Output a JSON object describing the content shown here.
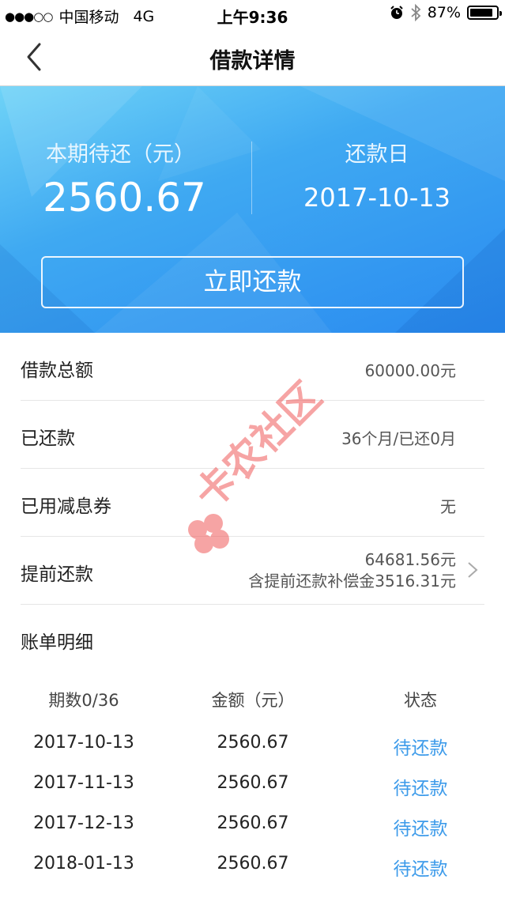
{
  "status_bar": {
    "carrier": "中国移动",
    "network": "4G",
    "time": "上午9:36",
    "battery": "87%",
    "battery_level": 0.87
  },
  "nav": {
    "title": "借款详情"
  },
  "summary": {
    "due_label": "本期待还（元）",
    "due_amount": "2560.67",
    "date_label": "还款日",
    "date_value": "2017-10-13",
    "repay_button": "立即还款"
  },
  "details": [
    {
      "label": "借款总额",
      "value": "60000.00元"
    },
    {
      "label": "已还款",
      "value": "36个月/已还0月"
    },
    {
      "label": "已用减息券",
      "value": "无"
    }
  ],
  "prepay": {
    "label": "提前还款",
    "amount": "64681.56元",
    "note": "含提前还款补偿金3516.31元"
  },
  "bill": {
    "title": "账单明细",
    "headers": [
      "期数0/36",
      "金额（元）",
      "状态"
    ],
    "rows": [
      {
        "date": "2017-10-13",
        "amount": "2560.67",
        "status": "待还款"
      },
      {
        "date": "2017-11-13",
        "amount": "2560.67",
        "status": "待还款"
      },
      {
        "date": "2017-12-13",
        "amount": "2560.67",
        "status": "待还款"
      },
      {
        "date": "2018-01-13",
        "amount": "2560.67",
        "status": "待还款"
      }
    ]
  },
  "colors": {
    "banner_start": "#6fd3f7",
    "banner_end": "#2a8bf0",
    "link": "#3d9bea",
    "watermark": "#f05a5a"
  },
  "watermark_text": "卡农社区"
}
